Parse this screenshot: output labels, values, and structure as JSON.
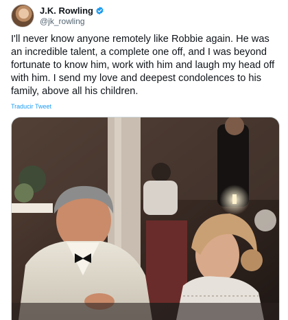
{
  "author": {
    "name": "J.K. Rowling",
    "handle": "@jk_rowling",
    "verified_icon": "verified-badge-icon"
  },
  "tweet": {
    "text": "I'll never know anyone remotely like Robbie again. He was an incredible talent, a complete one off, and I was beyond fortunate to know him, work with him and laugh my head off with him. I send my love and deepest condolences to his family, above all his children.",
    "translate_label": "Traducir Tweet"
  },
  "colors": {
    "accent": "#1d9bf0",
    "text": "#0f1419",
    "secondary": "#536471"
  }
}
